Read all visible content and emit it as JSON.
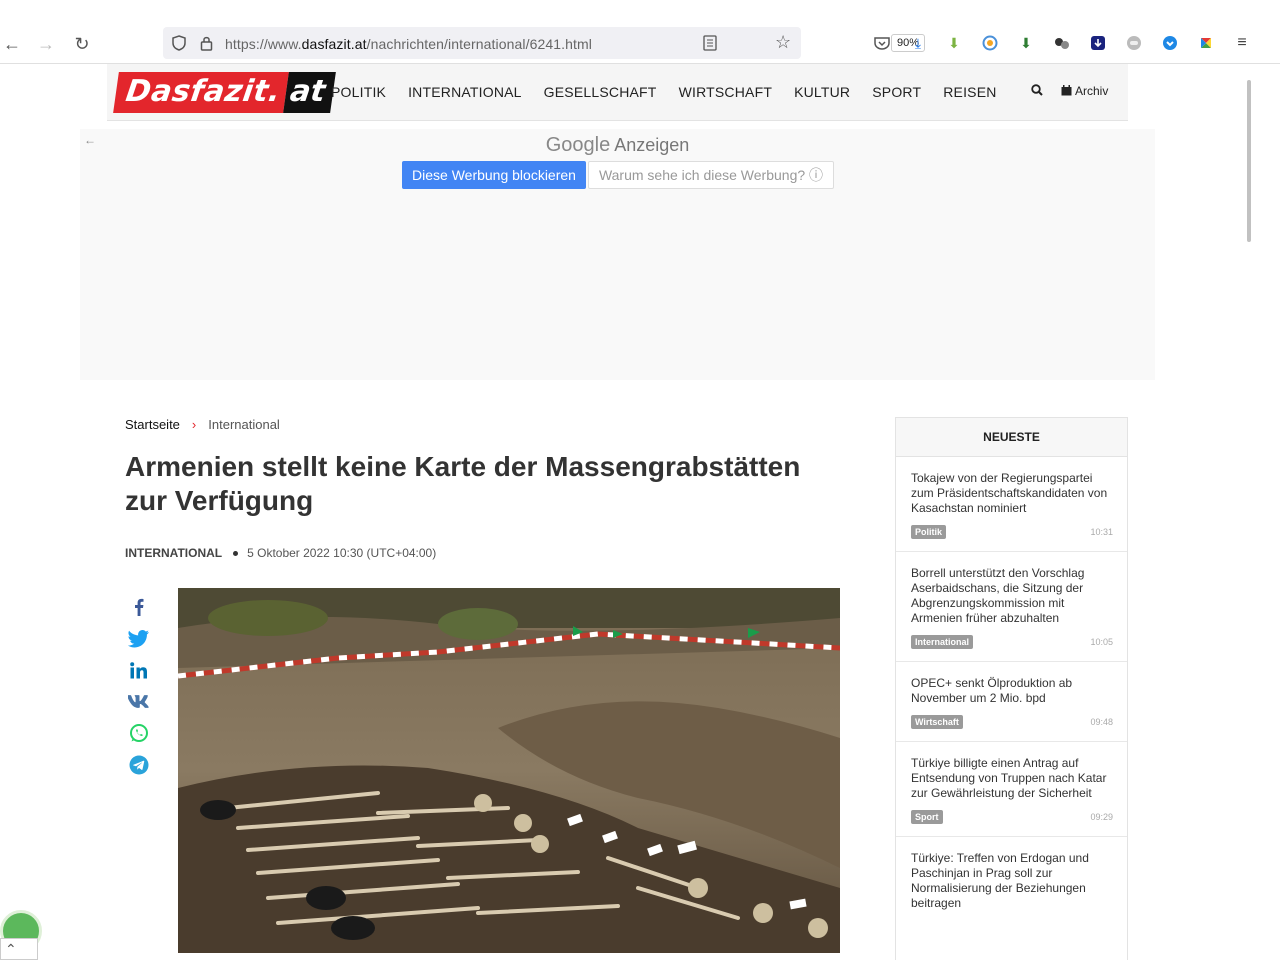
{
  "browser": {
    "url_prefix": "https://www.",
    "url_domain": "dasfazit.at",
    "url_path": "/nachrichten/international/6241.html",
    "zoom": "90%"
  },
  "site": {
    "logo_main": "Dasfazit.",
    "logo_tld": "at",
    "nav": [
      "POLITIK",
      "INTERNATIONAL",
      "GESELLSCHAFT",
      "WIRTSCHAFT",
      "KULTUR",
      "SPORT",
      "REISEN"
    ],
    "archiv": "Archiv"
  },
  "ad": {
    "google": "Google",
    "anzeigen": "Anzeigen",
    "block_label": "Diese Werbung blockieren",
    "why_label": "Warum sehe ich diese Werbung? ⓘ"
  },
  "article": {
    "breadcrumb_home": "Startseite",
    "breadcrumb_sep": "›",
    "breadcrumb_current": "International",
    "title": "Armenien stellt keine Karte der Massengrabstätten zur Verfügung",
    "category": "INTERNATIONAL",
    "date": "5 Oktober 2022 10:30 (UTC+04:00)"
  },
  "sidebar": {
    "title": "NEUESTE",
    "items": [
      {
        "text": "Tokajew von der Regierungspartei zum Präsidentschaftskandidaten von Kasachstan nominiert",
        "tag": "Politik",
        "time": "10:31"
      },
      {
        "text": "Borrell unterstützt den Vorschlag Aserbaidschans, die Sitzung der Abgrenzungskommission mit Armenien früher abzuhalten",
        "tag": "International",
        "time": "10:05"
      },
      {
        "text": "OPEC+ senkt Ölproduktion ab November um 2 Mio. bpd",
        "tag": "Wirtschaft",
        "time": "09:48"
      },
      {
        "text": "Türkiye billigte einen Antrag auf Entsendung von Truppen nach Katar zur Gewährleistung der Sicherheit",
        "tag": "Sport",
        "time": "09:29"
      },
      {
        "text": "Türkiye: Treffen von Erdogan und Paschinjan in Prag soll zur Normalisierung der Beziehungen beitragen",
        "tag": "",
        "time": ""
      }
    ]
  },
  "colors": {
    "brand_red": "#e3262c",
    "ad_blue": "#4285f4"
  }
}
